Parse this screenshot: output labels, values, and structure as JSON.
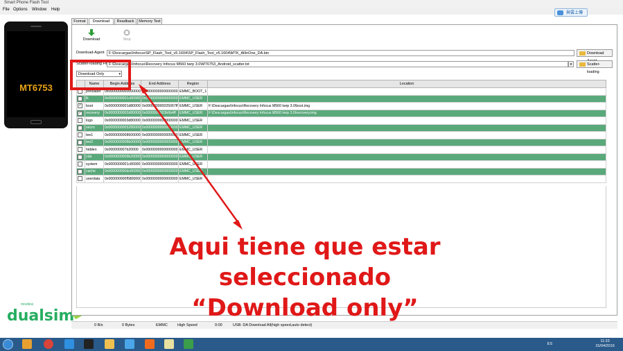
{
  "window": {
    "title": "Smart Phone Flash Tool"
  },
  "menu": [
    "File",
    "Options",
    "Window",
    "Help"
  ],
  "upload_button": "與雲上傳",
  "device": {
    "chip": "MT6753"
  },
  "watermark": {
    "brand": "dualsim",
    "small": "movilesi"
  },
  "tabs": [
    "Format",
    "Download",
    "Readback",
    "Memory Test"
  ],
  "toolbar": {
    "download": "Download",
    "stop": "Stop"
  },
  "download_agent": {
    "label": "Download-Agent",
    "value": "F:\\Descargas\\Infocus\\SP_Flash_Tool_v5.1604\\SP_Flash_Tool_v5.1604\\MTK_AllInOne_DA.bin",
    "button": "Download Agent"
  },
  "scatter": {
    "label": "Scatter-loading File",
    "value": "F:\\Descargas\\Infocus\\Recovery Infocus M560 twrp 3.0\\MT6753_Android_scatter.txt",
    "button": "Scatter-loading"
  },
  "mode_select": "Download Only",
  "table": {
    "headers": [
      "",
      "Name",
      "Begin Address",
      "End Address",
      "Region",
      "Location"
    ],
    "rows": [
      {
        "checked": false,
        "name": "preloader",
        "begin": "0x0000000000000000",
        "end": "0x0000000000000000",
        "region": "EMMC_BOOT_1",
        "location": ""
      },
      {
        "checked": false,
        "name": "lk",
        "begin": "0x0000000001c80000",
        "end": "0x0000000000000000",
        "region": "EMMC_USER",
        "location": ""
      },
      {
        "checked": true,
        "name": "boot",
        "begin": "0x0000000001d80000",
        "end": "0x000000000025067ff",
        "region": "EMMC_USER",
        "location": "F:\\Descargas\\Infocus\\Recovery Infocus M560 twrp 3.0\\boot.img"
      },
      {
        "checked": true,
        "name": "recovery",
        "begin": "0x0000000002d80000",
        "end": "0x0000000003b6b4ff",
        "region": "EMMC_USER",
        "location": "F:\\Descargas\\Infocus\\Recovery Infocus M560 twrp 3.0\\recovery.img"
      },
      {
        "checked": false,
        "name": "logo",
        "begin": "0x0000000003d80000",
        "end": "0x0000000000000000",
        "region": "EMMC_USER",
        "location": ""
      },
      {
        "checked": false,
        "name": "secro",
        "begin": "0x0000000005280000",
        "end": "0x0000000000000000",
        "region": "EMMC_USER",
        "location": ""
      },
      {
        "checked": false,
        "name": "tee1",
        "begin": "0x0000000008600000",
        "end": "0x0000000000000000",
        "region": "EMMC_USER",
        "location": ""
      },
      {
        "checked": false,
        "name": "tee2",
        "begin": "0x0000000008b00000",
        "end": "0x0000000000000000",
        "region": "EMMC_USER",
        "location": ""
      },
      {
        "checked": false,
        "name": "hidden",
        "begin": "0x000000007b20000",
        "end": "0x0000000000000000",
        "region": "EMMC_USER",
        "location": ""
      },
      {
        "checked": false,
        "name": "cda",
        "begin": "0x0000000009b20000",
        "end": "0x0000000000000000",
        "region": "EMMC_USER",
        "location": ""
      },
      {
        "checked": false,
        "name": "system",
        "begin": "0x0000000001c80000",
        "end": "0x0000000000000000",
        "region": "EMMC_USER",
        "location": ""
      },
      {
        "checked": false,
        "name": "cache",
        "begin": "0x000000000dc80000",
        "end": "0x0000000000000000",
        "region": "EMMC_USER",
        "location": ""
      },
      {
        "checked": false,
        "name": "userdata",
        "begin": "0x000000000f5800000",
        "end": "0x0000000000000000",
        "region": "EMMC_USER",
        "location": ""
      }
    ]
  },
  "annotation": {
    "line1": "Aqui tiene que estar seleccionado",
    "line2": "“Download only”"
  },
  "status": {
    "speed": "0 B/s",
    "bytes": "0 Bytes",
    "storage": "EMMC",
    "usb": "High Speed",
    "time": "0:00",
    "message": "USB: DA Download All(high speed,auto detect)"
  },
  "tray": {
    "lang": "ES",
    "time": "11:33",
    "date": "15/04/2016"
  },
  "colors": {
    "row_green": "#5aa97b",
    "annotation_red": "#e01818",
    "taskbar": "#2a5a8a"
  }
}
